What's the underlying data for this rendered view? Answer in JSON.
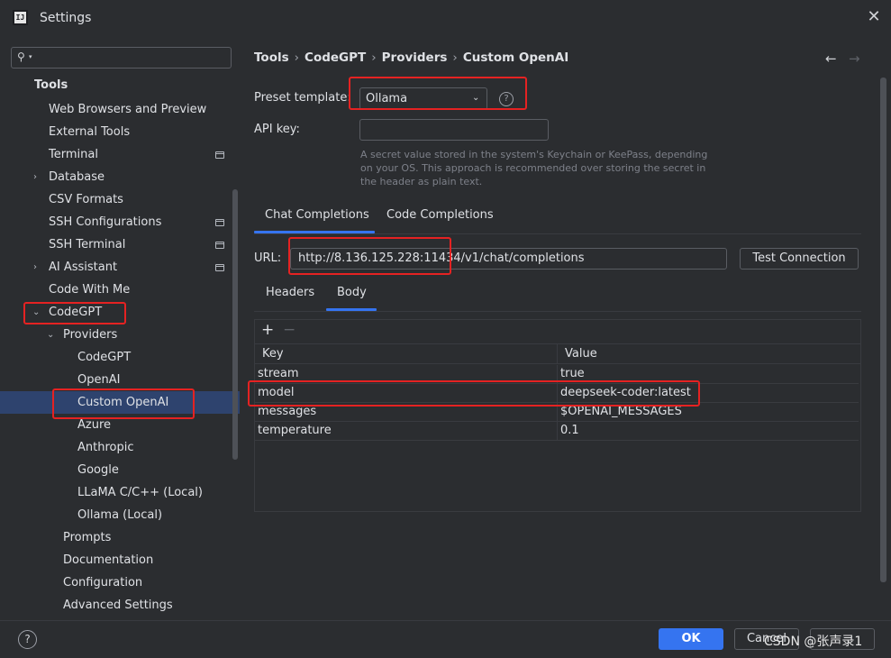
{
  "window": {
    "title": "Settings",
    "app_icon_text": "IJ"
  },
  "sidebar": {
    "search_placeholder": "",
    "items": [
      {
        "label": "Tools"
      },
      {
        "label": "Web Browsers and Preview"
      },
      {
        "label": "External Tools"
      },
      {
        "label": "Terminal"
      },
      {
        "label": "Database"
      },
      {
        "label": "CSV Formats"
      },
      {
        "label": "SSH Configurations"
      },
      {
        "label": "SSH Terminal"
      },
      {
        "label": "AI Assistant"
      },
      {
        "label": "Code With Me"
      },
      {
        "label": "CodeGPT"
      },
      {
        "label": "Providers"
      },
      {
        "label": "CodeGPT"
      },
      {
        "label": "OpenAI"
      },
      {
        "label": "Custom OpenAI"
      },
      {
        "label": "Azure"
      },
      {
        "label": "Anthropic"
      },
      {
        "label": "Google"
      },
      {
        "label": "LLaMA C/C++ (Local)"
      },
      {
        "label": "Ollama (Local)"
      },
      {
        "label": "Prompts"
      },
      {
        "label": "Documentation"
      },
      {
        "label": "Configuration"
      },
      {
        "label": "Advanced Settings"
      }
    ]
  },
  "breadcrumb": [
    "Tools",
    "CodeGPT",
    "Providers",
    "Custom OpenAI"
  ],
  "form": {
    "preset_label": "Preset template:",
    "preset_value": "Ollama",
    "api_key_label": "API key:",
    "api_key_value": "",
    "api_key_hint": "A secret value stored in the system's Keychain or KeePass, depending on your OS. This approach is recommended over storing the secret in the header as plain text."
  },
  "tabs": [
    "Chat Completions",
    "Code Completions"
  ],
  "url_row": {
    "label": "URL:",
    "value": "http://8.136.125.228:11434/v1/chat/completions",
    "test_button": "Test Connection"
  },
  "subtabs": [
    "Headers",
    "Body"
  ],
  "table": {
    "columns": [
      "Key",
      "Value"
    ],
    "rows": [
      {
        "key": "stream",
        "value": "true"
      },
      {
        "key": "model",
        "value": "deepseek-coder:latest"
      },
      {
        "key": "messages",
        "value": "$OPENAI_MESSAGES"
      },
      {
        "key": "temperature",
        "value": "0.1"
      }
    ]
  },
  "footer": {
    "help": "?",
    "ok": "OK",
    "cancel": "Cancel",
    "watermark": "CSDN @张声录1"
  },
  "colors": {
    "accent": "#3574f0",
    "highlight": "#e52222",
    "selection": "#2e436e"
  }
}
